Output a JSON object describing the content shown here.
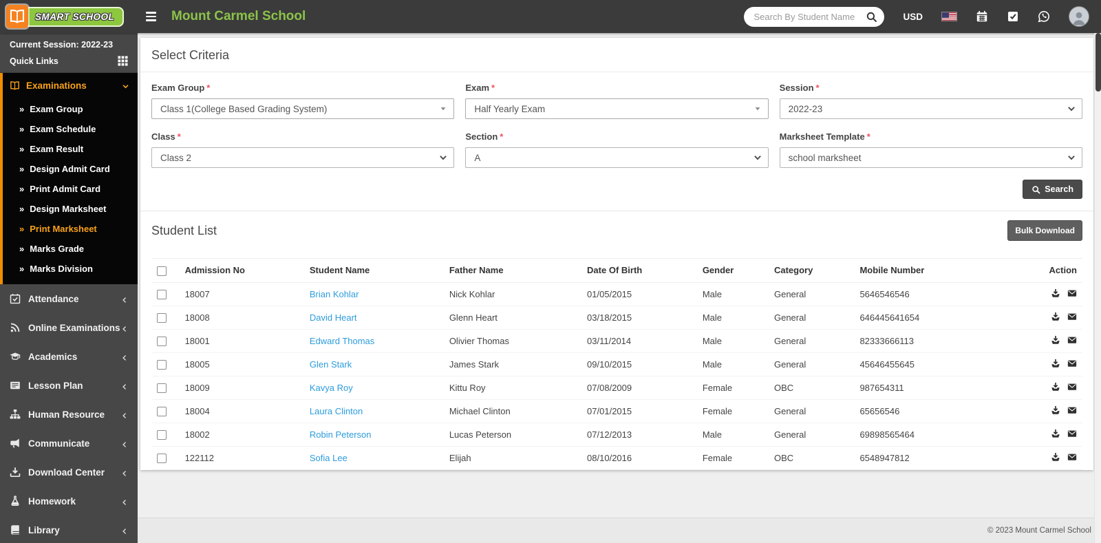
{
  "header": {
    "logo_text": "SMART SCHOOL",
    "school_name": "Mount Carmel School",
    "search_placeholder": "Search By Student Name",
    "currency": "USD"
  },
  "sidebar": {
    "session_label": "Current Session: 2022-23",
    "quick_links_label": "Quick Links",
    "active_group": {
      "label": "Examinations",
      "icon": "open-book-icon",
      "items": [
        "Exam Group",
        "Exam Schedule",
        "Exam Result",
        "Design Admit Card",
        "Print Admit Card",
        "Design Marksheet",
        "Print Marksheet",
        "Marks Grade",
        "Marks Division"
      ],
      "active_item": "Print Marksheet"
    },
    "groups": [
      {
        "label": "Attendance",
        "icon": "calendar-check-icon"
      },
      {
        "label": "Online Examinations",
        "icon": "rss-icon"
      },
      {
        "label": "Academics",
        "icon": "graduation-cap-icon"
      },
      {
        "label": "Lesson Plan",
        "icon": "newspaper-icon"
      },
      {
        "label": "Human Resource",
        "icon": "sitemap-icon"
      },
      {
        "label": "Communicate",
        "icon": "bullhorn-icon"
      },
      {
        "label": "Download Center",
        "icon": "download-icon"
      },
      {
        "label": "Homework",
        "icon": "flask-icon"
      },
      {
        "label": "Library",
        "icon": "book-icon"
      }
    ]
  },
  "criteria": {
    "title": "Select Criteria",
    "fields": [
      {
        "label": "Exam Group",
        "value": "Class 1(College Based Grading System)",
        "widget": "select2"
      },
      {
        "label": "Exam",
        "value": "Half Yearly Exam",
        "widget": "select2"
      },
      {
        "label": "Session",
        "value": "2022-23",
        "widget": "select"
      },
      {
        "label": "Class",
        "value": "Class 2",
        "widget": "select"
      },
      {
        "label": "Section",
        "value": "A",
        "widget": "select"
      },
      {
        "label": "Marksheet Template",
        "value": "school marksheet",
        "widget": "select"
      }
    ],
    "search_button": "Search"
  },
  "student_list": {
    "title": "Student List",
    "bulk_download_button": "Bulk Download",
    "columns": [
      "Admission No",
      "Student Name",
      "Father Name",
      "Date Of Birth",
      "Gender",
      "Category",
      "Mobile Number",
      "Action"
    ],
    "rows": [
      {
        "admission_no": "18007",
        "student_name": "Brian Kohlar",
        "father_name": "Nick Kohlar",
        "dob": "01/05/2015",
        "gender": "Male",
        "category": "General",
        "mobile": "5646546546"
      },
      {
        "admission_no": "18008",
        "student_name": "David Heart",
        "father_name": "Glenn Heart",
        "dob": "03/18/2015",
        "gender": "Male",
        "category": "General",
        "mobile": "646445641654"
      },
      {
        "admission_no": "18001",
        "student_name": "Edward Thomas",
        "father_name": "Olivier Thomas",
        "dob": "03/11/2014",
        "gender": "Male",
        "category": "General",
        "mobile": "82333666113"
      },
      {
        "admission_no": "18005",
        "student_name": "Glen Stark",
        "father_name": "James Stark",
        "dob": "09/10/2015",
        "gender": "Male",
        "category": "General",
        "mobile": "45646455645"
      },
      {
        "admission_no": "18009",
        "student_name": "Kavya Roy",
        "father_name": "Kittu Roy",
        "dob": "07/08/2009",
        "gender": "Female",
        "category": "OBC",
        "mobile": "987654311"
      },
      {
        "admission_no": "18004",
        "student_name": "Laura Clinton",
        "father_name": "Michael Clinton",
        "dob": "07/01/2015",
        "gender": "Female",
        "category": "General",
        "mobile": "65656546"
      },
      {
        "admission_no": "18002",
        "student_name": "Robin Peterson",
        "father_name": "Lucas Peterson",
        "dob": "07/12/2013",
        "gender": "Male",
        "category": "General",
        "mobile": "69898565464"
      },
      {
        "admission_no": "122112",
        "student_name": "Sofia Lee",
        "father_name": "Elijah",
        "dob": "08/10/2016",
        "gender": "Female",
        "category": "OBC",
        "mobile": "6548947812"
      }
    ]
  },
  "footer": {
    "copyright": "© 2023 Mount Carmel School"
  },
  "colors": {
    "accent_orange": "#ef8e00",
    "brand_green": "#8dc63f",
    "title_green": "#8bc34a",
    "link_blue": "#2d9cdb",
    "header_bg": "#3b3b3b",
    "sidebar_bg": "#474747",
    "button_dark": "#4a4a4a"
  }
}
